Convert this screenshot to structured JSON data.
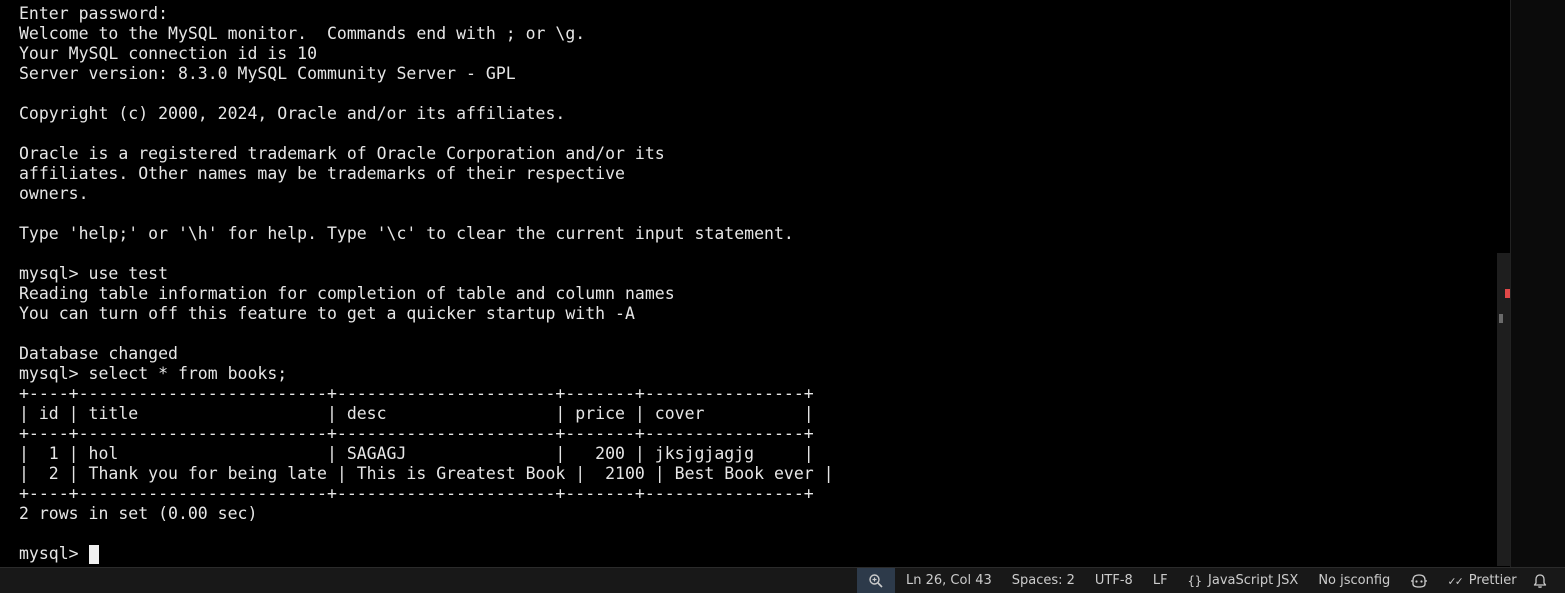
{
  "terminal": {
    "lines": [
      "Enter password:",
      "Welcome to the MySQL monitor.  Commands end with ; or \\g.",
      "Your MySQL connection id is 10",
      "Server version: 8.3.0 MySQL Community Server - GPL",
      "",
      "Copyright (c) 2000, 2024, Oracle and/or its affiliates.",
      "",
      "Oracle is a registered trademark of Oracle Corporation and/or its",
      "affiliates. Other names may be trademarks of their respective",
      "owners.",
      "",
      "Type 'help;' or '\\h' for help. Type '\\c' to clear the current input statement.",
      "",
      "mysql> use test",
      "Reading table information for completion of table and column names",
      "You can turn off this feature to get a quicker startup with -A",
      "",
      "Database changed",
      "mysql> select * from books;",
      "+----+-------------------------+----------------------+-------+----------------+",
      "| id | title                   | desc                 | price | cover          |",
      "+----+-------------------------+----------------------+-------+----------------+",
      "|  1 | hol                     | SAGAGJ               |   200 | jksjgjagjg     |",
      "|  2 | Thank you for being late | This is Greatest Book |  2100 | Best Book ever |",
      "+----+-------------------------+----------------------+-------+----------------+",
      "2 rows in set (0.00 sec)",
      ""
    ],
    "prompt": "mysql> "
  },
  "statusbar": {
    "zoom_icon": "zoom-icon",
    "position": "Ln 26, Col 43",
    "spaces": "Spaces: 2",
    "encoding": "UTF-8",
    "eol": "LF",
    "language_glyph": "{}",
    "language": "JavaScript JSX",
    "jsconfig": "No jsconfig",
    "copilot_icon": "copilot-icon",
    "prettier_glyph": "✓✓",
    "prettier": "Prettier",
    "bell_icon": "bell-icon"
  },
  "colors": {
    "terminal_bg": "#000000",
    "terminal_fg": "#e6e6e6",
    "statusbar_bg": "#181818",
    "statusbar_fg": "#cccccc",
    "zoom_bg": "#2d3a4a",
    "error_mark": "#e04848"
  }
}
